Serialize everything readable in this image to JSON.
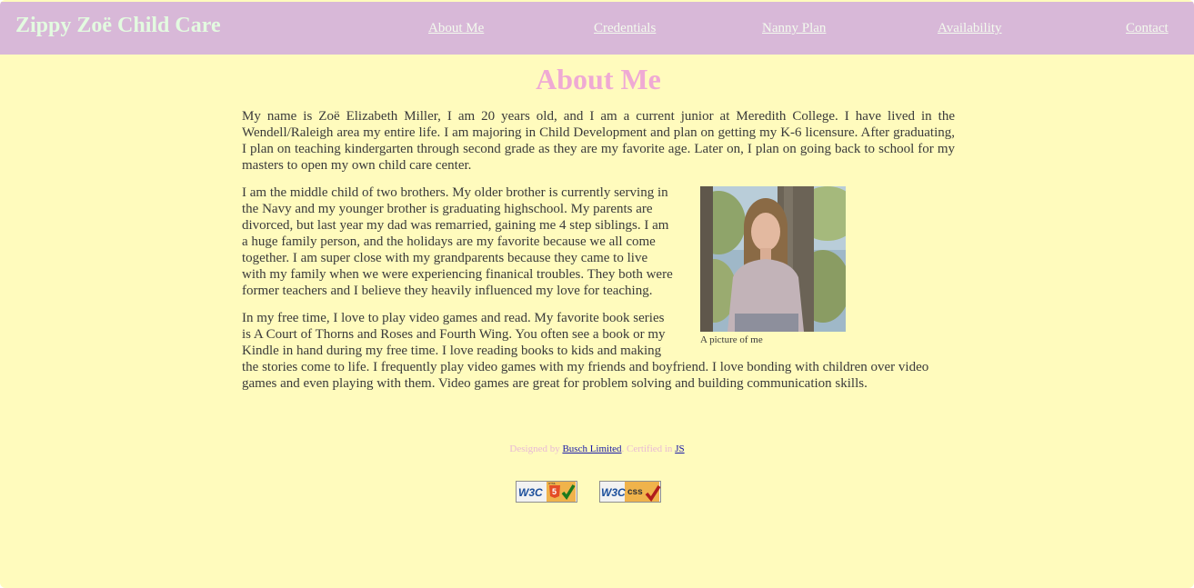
{
  "header": {
    "site_title": "Zippy Zoë Child Care",
    "nav": [
      "About Me",
      "Credentials",
      "Nanny Plan",
      "Availability",
      "Contact"
    ]
  },
  "main": {
    "heading": "About Me",
    "paragraphs": [
      "My name is Zoë Elizabeth Miller, I am 20 years old, and I am a current junior at Meredith College. I have lived in the Wendell/Raleigh area my entire life. I am majoring in Child Development and plan on getting my K-6 licensure. After graduating, I plan on teaching kindergarten through second grade as they are my favorite age. Later on, I plan on going back to school for my masters to open my own child care center.",
      "I am the middle child of two brothers. My older brother is currently serving in the Navy and my younger brother is graduating highschool. My parents are divorced, but last year my dad was remarried, gaining me 4 step siblings. I am a huge family person, and the holidays are my favorite because we all come together. I am super close with my grandparents because they came to live with my family when we were experiencing finanical troubles. They both were former teachers and I believe they heavily influenced my love for teaching.",
      "In my free time, I love to play video games and read. My favorite book series is A Court of Thorns and Roses and Fourth Wing. You often see a book or my Kindle in hand during my free time. I love reading books to kids and making the stories come to life. I frequently play video games with my friends and boyfriend. I love bonding with children over video games and even playing with them. Video games are great for problem solving and building communication skills."
    ],
    "photo_caption": "A picture of me"
  },
  "footer": {
    "designed_by": "Designed by",
    "designer_link": "Busch Limited",
    "certified_in": ". Certified in",
    "cert_link": "JS"
  },
  "badges": {
    "html_badge_text": "W3C",
    "html_badge_label": "HTML",
    "css_badge_text": "W3C",
    "css_badge_label": "css"
  },
  "colors": {
    "background": "#fffbbd",
    "header_bg": "#d8b8d8",
    "heading": "#efaad4",
    "body_text": "#3a3a3a"
  }
}
